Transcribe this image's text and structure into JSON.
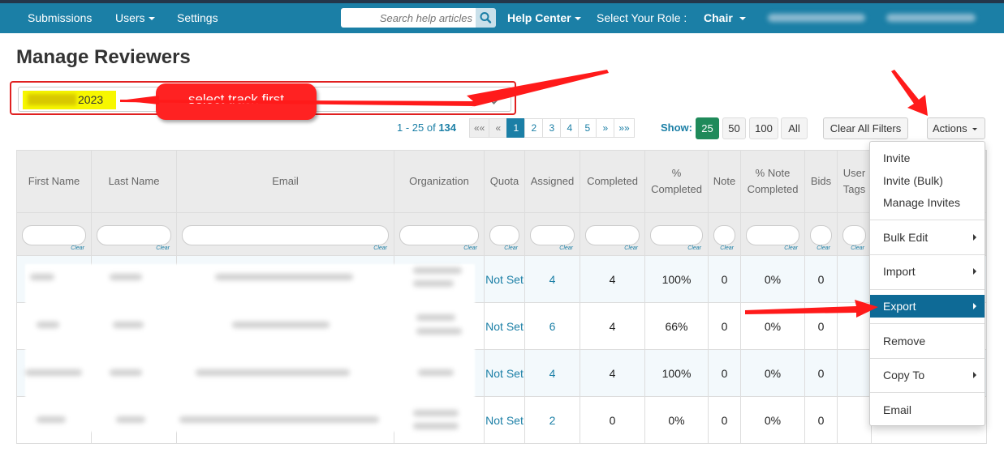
{
  "nav": {
    "submissions": "Submissions",
    "users": "Users",
    "settings": "Settings",
    "search_placeholder": "Search help articles",
    "help_center": "Help Center",
    "role_label": "Select Your Role :",
    "role_value": "Chair"
  },
  "page_title": "Manage Reviewers",
  "track": {
    "value_suffix": "2023"
  },
  "callout": "select track first",
  "pager": {
    "range": "1 - 25 of",
    "total": "134",
    "first": "««",
    "prev": "«",
    "pages": [
      "1",
      "2",
      "3",
      "4",
      "5"
    ],
    "next": "»",
    "last": "»»",
    "show_label": "Show:",
    "show_options": [
      "25",
      "50",
      "100",
      "All"
    ]
  },
  "buttons": {
    "clear_filters": "Clear All Filters",
    "actions": "Actions"
  },
  "table": {
    "headers": [
      "First Name",
      "Last Name",
      "Email",
      "Organization",
      "Quota",
      "Assigned",
      "Completed",
      "% Completed",
      "Note",
      "% Note Completed",
      "Bids",
      "User Tags"
    ],
    "clear_label": "Clear",
    "rows": [
      {
        "quota": "Not Set",
        "assigned": "4",
        "completed": "4",
        "pct": "100%",
        "note": "0",
        "note_pct": "0%",
        "bids": "0"
      },
      {
        "quota": "Not Set",
        "assigned": "6",
        "completed": "4",
        "pct": "66%",
        "note": "0",
        "note_pct": "0%",
        "bids": "0"
      },
      {
        "quota": "Not Set",
        "assigned": "4",
        "completed": "4",
        "pct": "100%",
        "note": "0",
        "note_pct": "0%",
        "bids": "0"
      },
      {
        "quota": "Not Set",
        "assigned": "2",
        "completed": "0",
        "pct": "0%",
        "note": "0",
        "note_pct": "0%",
        "bids": "0"
      }
    ]
  },
  "actions_menu": [
    "Invite",
    "Invite (Bulk)",
    "Manage Invites",
    "Bulk Edit",
    "Import",
    "Export",
    "Remove",
    "Copy To",
    "Email"
  ],
  "colors": {
    "nav_bg": "#1b7fa6",
    "accent": "#1b7fa6",
    "highlight": "#0e6a96",
    "annotation": "#ff2222"
  }
}
